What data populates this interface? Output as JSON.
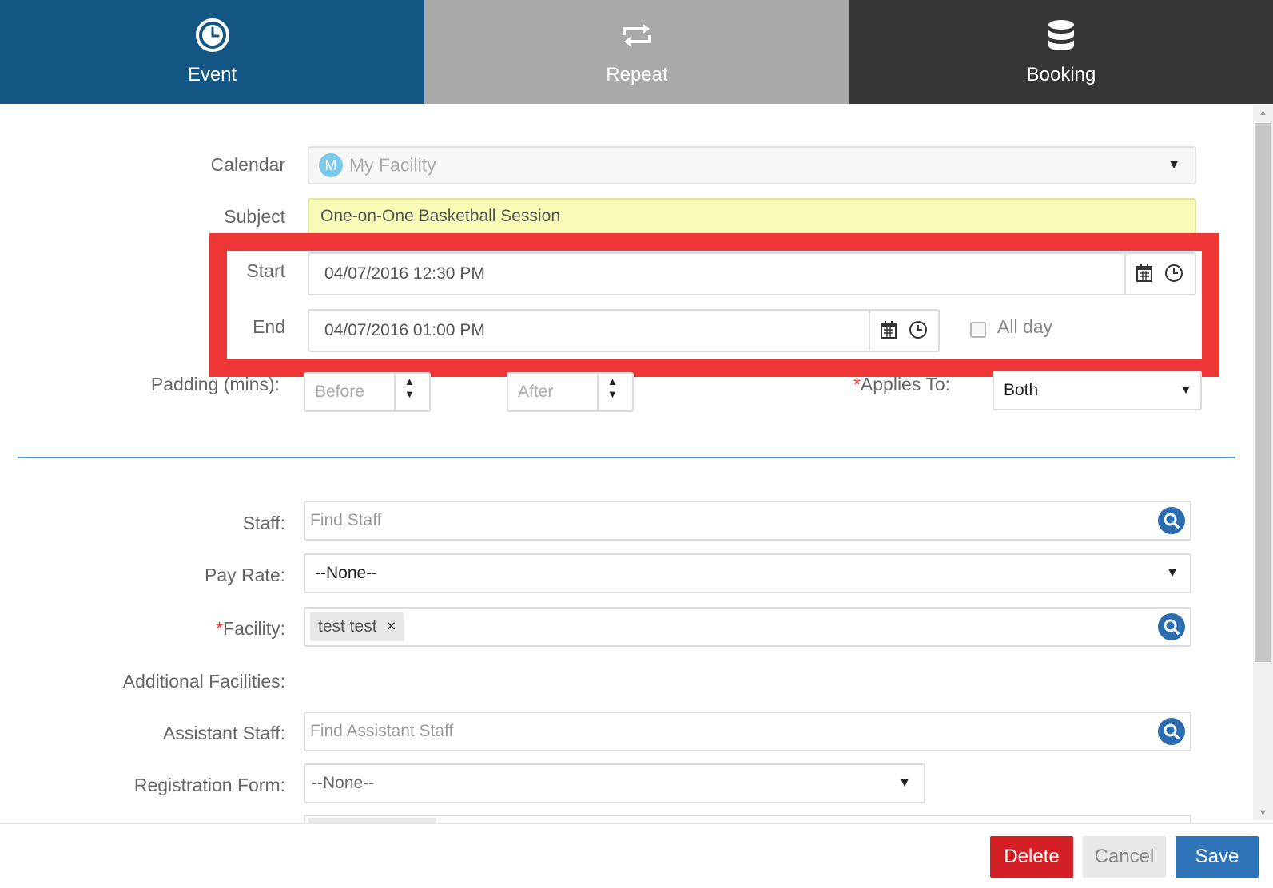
{
  "tabs": [
    {
      "label": "Event",
      "icon": "clock-icon"
    },
    {
      "label": "Repeat",
      "icon": "repeat-icon"
    },
    {
      "label": "Booking",
      "icon": "database-icon"
    }
  ],
  "colors": {
    "tab_event": "#145683",
    "tab_repeat": "#a9a9a9",
    "tab_booking": "#363636",
    "highlight": "#ee3636",
    "delete": "#d32027",
    "save": "#2f73b8",
    "subject_bg": "#fafbb6"
  },
  "form": {
    "calendar": {
      "label": "Calendar",
      "avatar": "M",
      "value": "My Facility"
    },
    "subject": {
      "label": "Subject",
      "value": "One-on-One Basketball Session"
    },
    "start": {
      "label": "Start",
      "value": "04/07/2016 12:30 PM"
    },
    "end": {
      "label": "End",
      "value": "04/07/2016 01:00 PM"
    },
    "all_day": {
      "label": "All day",
      "checked": false
    },
    "padding": {
      "label": "Padding (mins):",
      "before_placeholder": "Before",
      "after_placeholder": "After"
    },
    "applies_to": {
      "required_mark": "*",
      "label": "Applies To:",
      "value": "Both"
    },
    "staff": {
      "label": "Staff:",
      "placeholder": "Find Staff"
    },
    "pay_rate": {
      "label": "Pay Rate:",
      "value": "--None--"
    },
    "facility": {
      "required_mark": "*",
      "label": "Facility:",
      "tag": "test test",
      "tag_remove": "×"
    },
    "additional_facilities": {
      "label": "Additional Facilities:"
    },
    "assistant_staff": {
      "label": "Assistant Staff:",
      "placeholder": "Find Assistant Staff"
    },
    "registration_form": {
      "label": "Registration Form:",
      "value": "--None--"
    }
  },
  "footer": {
    "delete_label": "Delete",
    "cancel_label": "Cancel",
    "save_label": "Save"
  }
}
